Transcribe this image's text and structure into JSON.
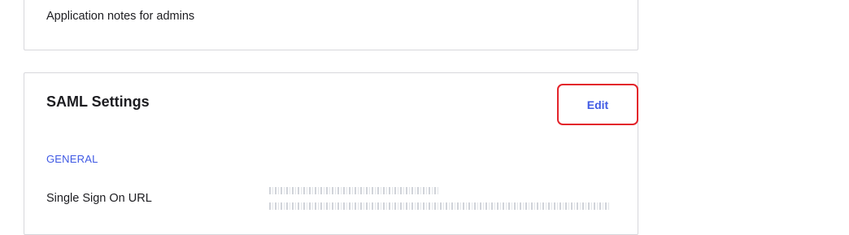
{
  "app_notes": {
    "label": "Application notes for admins"
  },
  "saml_settings": {
    "title": "SAML Settings",
    "edit_label": "Edit",
    "accent_color": "#3f59e4",
    "highlight_color": "#e3242b",
    "section_general": "GENERAL",
    "fields": [
      {
        "label": "Single Sign On URL",
        "value_redacted": true
      }
    ]
  }
}
